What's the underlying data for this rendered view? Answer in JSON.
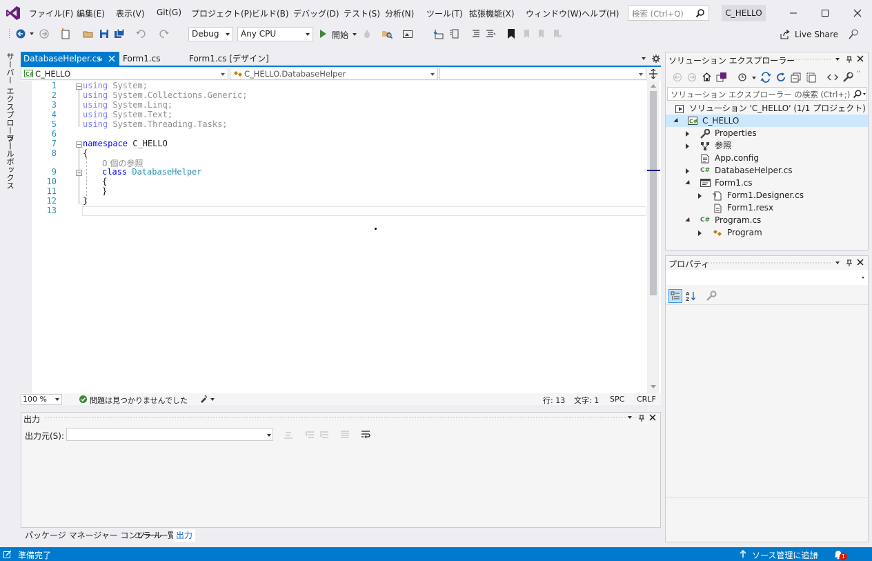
{
  "menu": {
    "items": [
      "ファイル(F)",
      "編集(E)",
      "表示(V)",
      "Git(G)",
      "プロジェクト(P)",
      "ビルド(B)",
      "デバッグ(D)",
      "テスト(S)",
      "分析(N)",
      "ツール(T)",
      "拡張機能(X)",
      "ウィンドウ(W)",
      "ヘルプ(H)"
    ],
    "search_placeholder": "検索 (Ctrl+Q)",
    "solution_name": "C_HELLO"
  },
  "toolbar": {
    "config": "Debug",
    "platform": "Any CPU",
    "start_label": "開始",
    "live_share": "Live Share"
  },
  "left_rail": {
    "server_explorer": "サーバー エクスプローラー",
    "toolbox": "ツールボックス"
  },
  "editor": {
    "tabs": [
      {
        "label": "DatabaseHelper.cs",
        "active": true
      },
      {
        "label": "Form1.cs",
        "active": false
      },
      {
        "label": "Form1.cs [デザイン]",
        "active": false
      }
    ],
    "nav": {
      "project": "C_HELLO",
      "type": "C_HELLO.DatabaseHelper",
      "member": ""
    },
    "line_numbers": [
      "1",
      "2",
      "3",
      "4",
      "5",
      "6",
      "7",
      "8",
      "",
      "9",
      "10",
      "11",
      "12",
      "13"
    ],
    "code": {
      "l1": [
        "using",
        " System;"
      ],
      "l2": [
        "using",
        " System.Collections.Generic;"
      ],
      "l3": [
        "using",
        " System.Linq;"
      ],
      "l4": [
        "using",
        " System.Text;"
      ],
      "l5": [
        "using",
        " System.Threading.Tasks;"
      ],
      "l7": [
        "namespace",
        " C_HELLO"
      ],
      "l8": "{",
      "refs_hint": "0 個の参照",
      "l9": [
        "class",
        " ",
        "DatabaseHelper"
      ],
      "l10": "{",
      "l11": "}",
      "l12": "}"
    },
    "status": {
      "zoom": "100 %",
      "issues": "問題は見つかりませんでした",
      "line": "行: 13",
      "char": "文字: 1",
      "spc": "SPC",
      "crlf": "CRLF"
    }
  },
  "output": {
    "title": "出力",
    "source_label": "出力元(S):",
    "source_value": ""
  },
  "bottom_tabs": [
    "パッケージ マネージャー コンソール",
    "エラー一覧",
    "出力"
  ],
  "solution_explorer": {
    "title": "ソリューション エクスプローラー",
    "search_placeholder": "ソリューション エクスプローラー の検索 (Ctrl+;)",
    "solution_label": "ソリューション 'C_HELLO' (1/1 プロジェクト)",
    "project": "C_HELLO",
    "nodes": [
      "Properties",
      "参照",
      "App.config",
      "DatabaseHelper.cs",
      "Form1.cs",
      "Form1.Designer.cs",
      "Form1.resx",
      "Program.cs",
      "Program"
    ]
  },
  "properties": {
    "title": "プロパティ"
  },
  "statusbar": {
    "ready": "準備完了",
    "source_control": "ソース管理に追加",
    "notification_count": "1"
  },
  "colors": {
    "accent": "#007acc",
    "vs_purple": "#68217a",
    "keyword": "#0000ff",
    "type": "#2b91af",
    "csharp_green": "#388a34"
  }
}
